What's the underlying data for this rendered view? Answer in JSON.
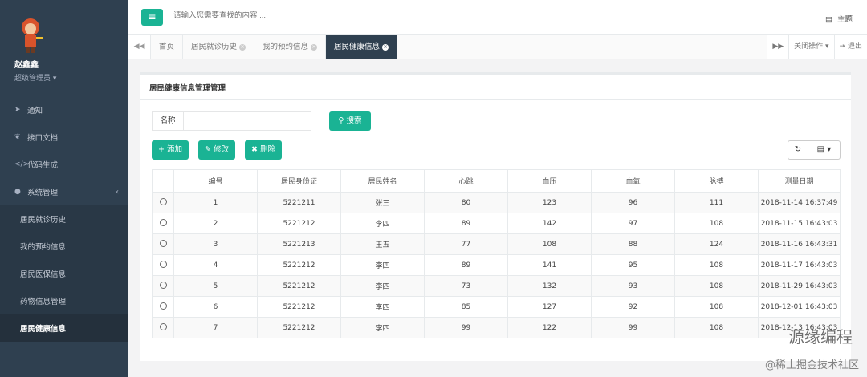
{
  "user": {
    "name": "赵鑫鑫",
    "role": "超级管理员"
  },
  "sidebar": {
    "items": [
      {
        "label": "通知",
        "icon": "paper-plane-icon"
      },
      {
        "label": "接口文档",
        "icon": "leaf-icon"
      },
      {
        "label": "代码生成",
        "icon": "code-icon"
      },
      {
        "label": "系统管理",
        "icon": "user-icon"
      }
    ],
    "sub": [
      "居民就诊历史",
      "我的预约信息",
      "居民医保信息",
      "药物信息管理",
      "居民健康信息"
    ]
  },
  "topbar": {
    "search_placeholder": "请输入您需要查找的内容 ...",
    "theme": "主题"
  },
  "tabs": [
    "首页",
    "居民就诊历史",
    "我的预约信息",
    "居民健康信息"
  ],
  "tab_actions": {
    "close_ops": "关闭操作",
    "logout": "退出"
  },
  "panel": {
    "title": "居民健康信息管理管理"
  },
  "search": {
    "label": "名称",
    "button": "搜索"
  },
  "toolbar": {
    "add": "添加",
    "edit": "修改",
    "delete": "删除"
  },
  "table": {
    "headers": [
      "编号",
      "居民身份证",
      "居民姓名",
      "心跳",
      "血压",
      "血氧",
      "脉搏",
      "测量日期"
    ],
    "rows": [
      [
        "1",
        "5221211",
        "张三",
        "80",
        "123",
        "96",
        "111",
        "2018-11-14 16:37:49"
      ],
      [
        "2",
        "5221212",
        "李四",
        "89",
        "142",
        "97",
        "108",
        "2018-11-15 16:43:03"
      ],
      [
        "3",
        "5221213",
        "王五",
        "77",
        "108",
        "88",
        "124",
        "2018-11-16 16:43:31"
      ],
      [
        "4",
        "5221212",
        "李四",
        "89",
        "141",
        "95",
        "108",
        "2018-11-17 16:43:03"
      ],
      [
        "5",
        "5221212",
        "李四",
        "73",
        "132",
        "93",
        "108",
        "2018-11-29 16:43:03"
      ],
      [
        "6",
        "5221212",
        "李四",
        "85",
        "127",
        "92",
        "108",
        "2018-12-01 16:43:03"
      ],
      [
        "7",
        "5221212",
        "李四",
        "99",
        "122",
        "99",
        "108",
        "2018-12-13 16:43:03"
      ]
    ]
  },
  "watermark": {
    "main": "源缘编程",
    "sub": "@稀土掘金技术社区"
  }
}
